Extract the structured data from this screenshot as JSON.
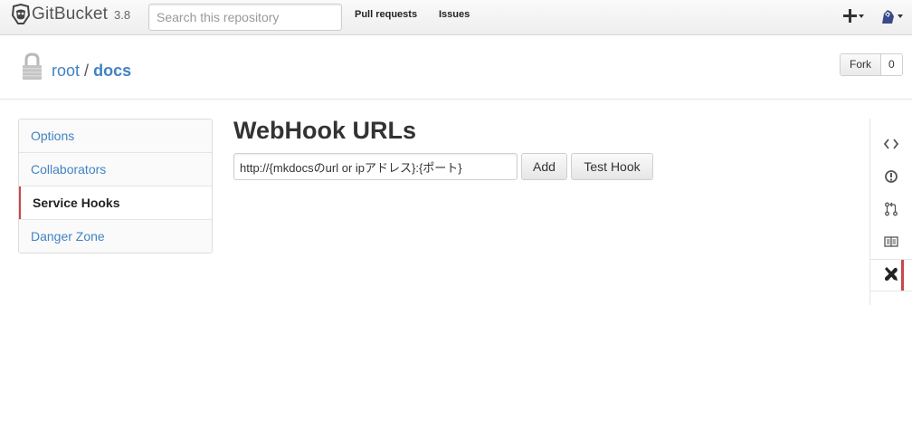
{
  "header": {
    "brand": "GitBucket",
    "version": "3.8",
    "search_placeholder": "Search this repository",
    "nav": [
      {
        "label": "Pull requests"
      },
      {
        "label": "Issues"
      }
    ]
  },
  "repo": {
    "owner": "root",
    "separator": "/",
    "name": "docs",
    "fork_label": "Fork",
    "fork_count": "0"
  },
  "settings_menu": {
    "items": [
      {
        "label": "Options",
        "selected": false
      },
      {
        "label": "Collaborators",
        "selected": false
      },
      {
        "label": "Service Hooks",
        "selected": true
      },
      {
        "label": "Danger Zone",
        "selected": false
      }
    ]
  },
  "main": {
    "title": "WebHook URLs",
    "hook_input_value": "http://{mkdocsのurl or ipアドレス}:{ポート}",
    "add_label": "Add",
    "test_label": "Test Hook"
  },
  "side_nav": {
    "items": [
      {
        "icon": "code-icon",
        "selected": false
      },
      {
        "icon": "issue-opened-icon",
        "selected": false
      },
      {
        "icon": "pull-request-icon",
        "selected": false
      },
      {
        "icon": "wiki-book-icon",
        "selected": false
      },
      {
        "icon": "settings-tools-icon",
        "selected": true
      }
    ]
  },
  "colors": {
    "link": "#4183c4",
    "accent_selected": "#c9484a",
    "text": "#333333"
  }
}
